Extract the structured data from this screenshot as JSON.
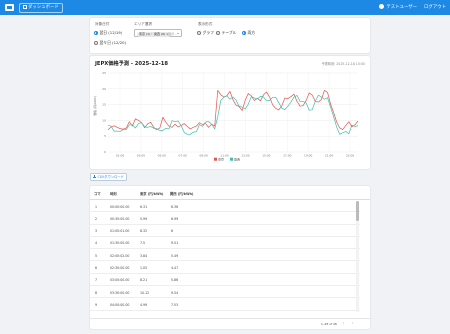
{
  "header": {
    "dashboard_label": "ダッシュボード",
    "user_name": "テストユーザー",
    "logout_label": "ログアウト"
  },
  "controls": {
    "date_label": "対象日付",
    "date_options": [
      "翌日 (12/19)",
      "翌々日 (12/20)"
    ],
    "date_selected_index": 0,
    "area_label": "エリア選択",
    "area_chips": [
      "東京 (1) × ",
      "関西 (6) × "
    ],
    "area_placeholder": "選択...",
    "display_label": "表示形式",
    "display_options": [
      "グラフ",
      "テーブル",
      "両方"
    ],
    "display_selected_index": 2
  },
  "chart_data": {
    "type": "line",
    "title": "JEPX価格予測 - 2025-12-18",
    "timestamp": "予測時刻: 2025-12-18 10:00",
    "ylabel": "価格 (円/kWh)",
    "ylim": [
      0,
      25
    ],
    "x_ticks": [
      "01:00",
      "03:00",
      "05:00",
      "07:00",
      "09:00",
      "11:00",
      "13:00",
      "15:00",
      "17:00",
      "19:00",
      "21:00",
      "23:00"
    ],
    "y_ticks": [
      "25",
      "20",
      "15",
      "10",
      "5",
      "0"
    ],
    "legend_position": "bottom-center",
    "series": [
      {
        "name": "東京",
        "color": "#e8534a",
        "values": [
          7.0,
          7.9,
          8.3,
          7.8,
          7.4,
          7.2,
          7.6,
          9.6,
          8.2,
          10.5,
          10.0,
          9.3,
          7.7,
          8.9,
          9.4,
          7.8,
          7.0,
          7.6,
          11.0,
          9.4,
          8.2,
          7.8,
          8.8,
          7.9,
          8.4,
          9.0,
          8.1,
          7.3,
          7.8,
          8.2,
          9.3,
          8.7,
          9.0,
          7.8,
          8.8,
          8.2,
          19.5,
          18.1,
          17.4,
          17.8,
          19.2,
          16.5,
          14.8,
          14.4,
          13.1,
          16.4,
          18.5,
          17.8,
          16.3,
          17.0,
          16.2,
          18.1,
          19.0,
          17.4,
          14.9,
          13.8,
          13.3,
          14.6,
          17.1,
          16.9,
          17.5,
          18.3,
          16.0,
          14.5,
          14.7,
          16.3,
          18.7,
          18.0,
          16.0,
          15.8,
          16.6,
          19.5,
          18.9,
          15.2,
          12.5,
          9.5,
          7.6,
          7.1,
          8.4,
          9.6,
          8.0,
          8.6,
          9.8
        ]
      },
      {
        "name": "関西",
        "color": "#3dbfb0",
        "values": [
          8.4,
          8.2,
          6.6,
          6.6,
          6.5,
          7.1,
          7.1,
          8.6,
          8.6,
          7.6,
          9.0,
          9.3,
          8.0,
          7.8,
          8.1,
          7.5,
          7.4,
          6.8,
          6.8,
          7.5,
          7.3,
          9.9,
          9.6,
          9.8,
          8.3,
          6.2,
          5.6,
          5.6,
          6.3,
          6.4,
          8.7,
          8.1,
          9.5,
          9.6,
          8.8,
          7.3,
          11.2,
          16.3,
          17.3,
          17.8,
          16.7,
          17.4,
          16.4,
          14.5,
          14.2,
          13.6,
          15.1,
          17.5,
          17.1,
          16.8,
          17.6,
          17.4,
          16.2,
          16.3,
          17.3,
          17.3,
          15.6,
          13.9,
          13.4,
          14.5,
          15.8,
          17.4,
          17.9,
          16.0,
          16.0,
          15.5,
          13.2,
          13.4,
          16.1,
          18.0,
          17.4,
          16.7,
          17.2,
          14.2,
          11.2,
          7.9,
          5.6,
          6.1,
          6.5,
          5.8,
          8.5,
          8.1,
          8.3
        ]
      }
    ]
  },
  "csv_button_label": "CSVダウンロード",
  "table": {
    "headers": [
      "コマ",
      "時刻",
      "東京 (円/kWh)",
      "関西 (円/kWh)"
    ],
    "rows": [
      [
        "1",
        "00:00:00.00",
        "6.31",
        "6.36"
      ],
      [
        "2",
        "00:30:00.00",
        "5.99",
        "6.99"
      ],
      [
        "3",
        "01:00:01.00",
        "8.32",
        "6"
      ],
      [
        "4",
        "01:30:00.00",
        "7.5",
        "9.51"
      ],
      [
        "5",
        "02:00:02.00",
        "3.84",
        "5.49"
      ],
      [
        "6",
        "02:30:00.00",
        "1.05",
        "4.47"
      ],
      [
        "7",
        "03:00:00.00",
        "8.21",
        "5.86"
      ],
      [
        "8",
        "03:30:00.00",
        "10.12",
        "9.54"
      ],
      [
        "9",
        "04:00:00.00",
        "4.99",
        "7.53"
      ]
    ]
  },
  "pager": {
    "range_text": "1–48 of 48",
    "prev_icon": "‹",
    "next_icon": "›"
  }
}
